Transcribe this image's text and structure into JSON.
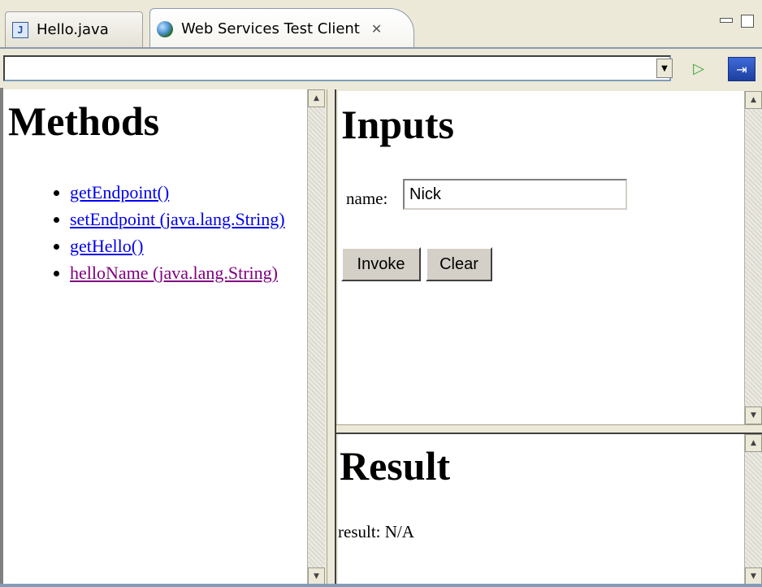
{
  "tabs": [
    {
      "label": "Hello.java",
      "icon": "java-file-icon",
      "active": false
    },
    {
      "label": "Web Services Test Client",
      "icon": "globe-icon",
      "active": true
    }
  ],
  "urlbar": {
    "value": "",
    "dropdown_icon": "chevron-down-icon",
    "go_icon": "play-icon",
    "nav_icon": "navigate-icon"
  },
  "methods": {
    "title": "Methods",
    "items": [
      {
        "label": "getEndpoint()",
        "visited": false
      },
      {
        "label": "setEndpoint (java.lang.String)",
        "visited": false
      },
      {
        "label": "getHello()",
        "visited": false
      },
      {
        "label": "helloName (java.lang.String)",
        "visited": true
      }
    ]
  },
  "inputs": {
    "title": "Inputs",
    "name_label": "name:",
    "name_value": "Nick",
    "invoke_label": "Invoke",
    "clear_label": "Clear"
  },
  "result": {
    "title": "Result",
    "text": "result: N/A"
  },
  "colors": {
    "link": "#0000ee",
    "visited_link": "#800080",
    "chrome": "#ece9d8"
  }
}
